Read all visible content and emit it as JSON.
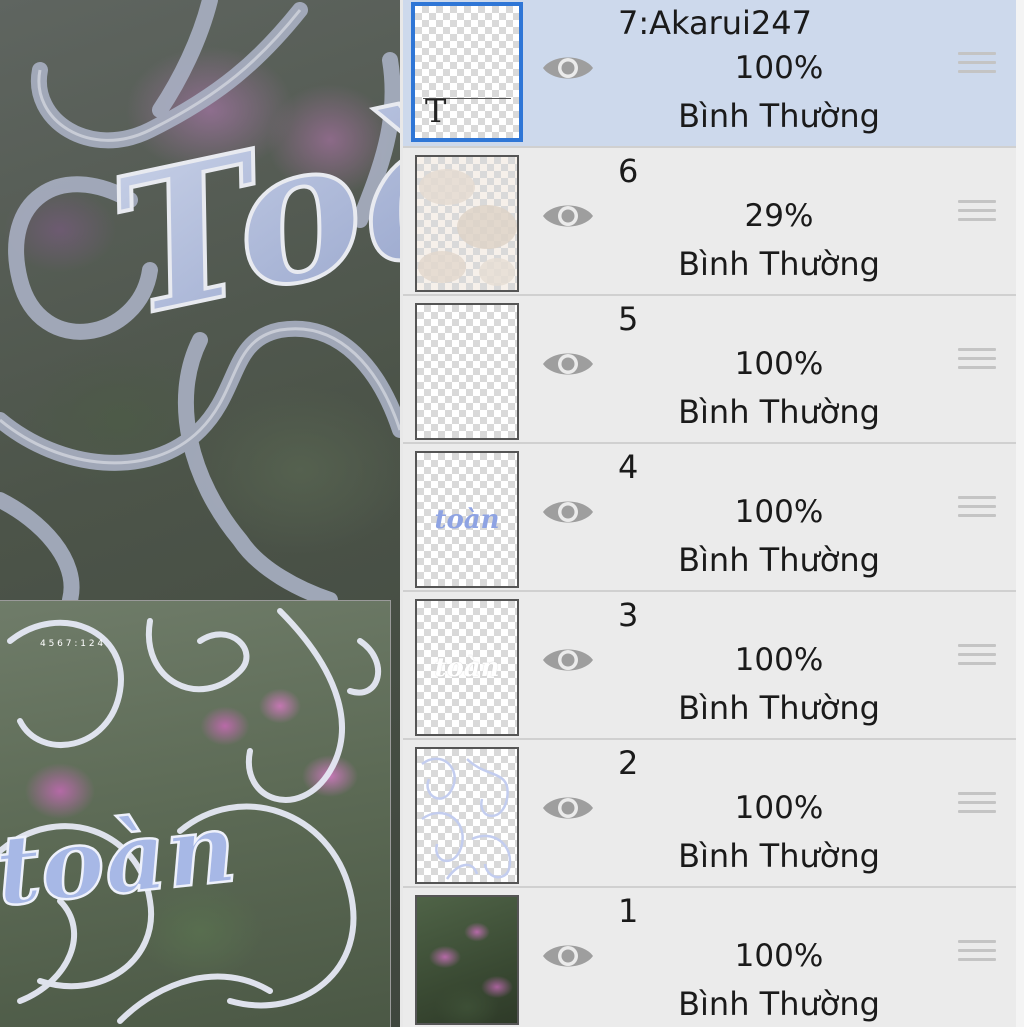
{
  "canvas": {
    "main_text": "Toàn",
    "preview_text": "toàn",
    "preview_timestamp": "4 5 6 7 : 1 2 4"
  },
  "layers": [
    {
      "name": "7:Akarui247",
      "opacity": "100%",
      "blend": "Bình Thường",
      "selected": true,
      "thumb": "text-layer",
      "visible_icon": "eye-icon"
    },
    {
      "name": "6",
      "opacity": "29%",
      "blend": "Bình Thường",
      "selected": false,
      "thumb": "haze",
      "visible_icon": "eye-icon"
    },
    {
      "name": "5",
      "opacity": "100%",
      "blend": "Bình Thường",
      "selected": false,
      "thumb": "empty",
      "visible_icon": "eye-icon"
    },
    {
      "name": "4",
      "opacity": "100%",
      "blend": "Bình Thường",
      "selected": false,
      "thumb": "blue-text",
      "thumb_text": "toàn",
      "visible_icon": "eye-icon"
    },
    {
      "name": "3",
      "opacity": "100%",
      "blend": "Bình Thường",
      "selected": false,
      "thumb": "white-text",
      "thumb_text": "toàn",
      "visible_icon": "eye-icon"
    },
    {
      "name": "2",
      "opacity": "100%",
      "blend": "Bình Thường",
      "selected": false,
      "thumb": "swirls",
      "visible_icon": "eye-icon"
    },
    {
      "name": "1",
      "opacity": "100%",
      "blend": "Bình Thường",
      "selected": false,
      "thumb": "photo",
      "visible_icon": "eye-icon"
    }
  ],
  "colors": {
    "selected_row": "#cdd9ec",
    "selected_border": "#2f76d6",
    "row_bg": "#ebebeb"
  }
}
